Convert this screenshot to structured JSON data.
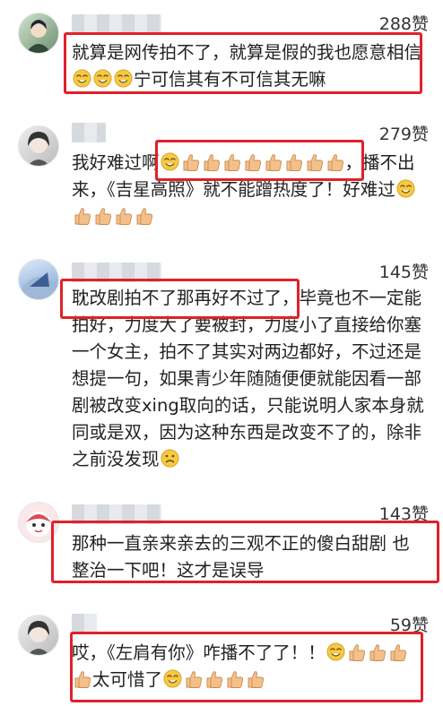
{
  "comments": [
    {
      "likes": "288赞",
      "segments": [
        {
          "t": "text",
          "v": "就算是网传拍不了，就算是假的我也愿意相信"
        },
        {
          "t": "emoji",
          "v": "smile-emoji"
        },
        {
          "t": "emoji",
          "v": "smile-emoji"
        },
        {
          "t": "emoji",
          "v": "smile-emoji"
        },
        {
          "t": "text",
          "v": "宁可信其有不可信其无嘛"
        }
      ]
    },
    {
      "likes": "279赞",
      "segments": [
        {
          "t": "text",
          "v": "我好难过啊"
        },
        {
          "t": "emoji",
          "v": "smile-emoji"
        },
        {
          "t": "thumb",
          "v": "thumbs-up"
        },
        {
          "t": "thumb",
          "v": "thumbs-up"
        },
        {
          "t": "thumb",
          "v": "thumbs-up"
        },
        {
          "t": "thumb",
          "v": "thumbs-up"
        },
        {
          "t": "thumb",
          "v": "thumbs-up"
        },
        {
          "t": "thumb",
          "v": "thumbs-up"
        },
        {
          "t": "thumb",
          "v": "thumbs-up"
        },
        {
          "t": "thumb",
          "v": "thumbs-up"
        },
        {
          "t": "text",
          "v": "，播不出来，《吉星高照》就不能蹭热度了！好难过"
        },
        {
          "t": "emoji",
          "v": "smile-emoji"
        },
        {
          "t": "thumb",
          "v": "thumbs-up"
        },
        {
          "t": "thumb",
          "v": "thumbs-up"
        },
        {
          "t": "thumb",
          "v": "thumbs-up"
        },
        {
          "t": "thumb",
          "v": "thumbs-up"
        }
      ]
    },
    {
      "likes": "145赞",
      "segments": [
        {
          "t": "text",
          "v": "耽改剧拍不了那再好不过了，毕竟也不一定能拍好，力度大了要被封，力度小了直接给你塞一个女主，拍不了其实对两边都好，不过还是想提一句，如果青少年随随便便就能因看一部剧被改变xing取向的话，只能说明人家本身就同或是双，因为这种东西是改变不了的，除非之前没发现"
        },
        {
          "t": "emoji",
          "v": "awkward-emoji"
        }
      ]
    },
    {
      "likes": "143赞",
      "segments": [
        {
          "t": "text",
          "v": "那种一直亲来亲去的三观不正的傻白甜剧 也整治一下吧！这才是误导"
        }
      ]
    },
    {
      "likes": "59赞",
      "segments": [
        {
          "t": "text",
          "v": "哎，《左肩有你》咋播不了了！！"
        },
        {
          "t": "emoji",
          "v": "smile-emoji"
        },
        {
          "t": "thumb",
          "v": "thumbs-up"
        },
        {
          "t": "thumb",
          "v": "thumbs-up"
        },
        {
          "t": "thumb",
          "v": "thumbs-up"
        },
        {
          "t": "thumb",
          "v": "thumbs-up"
        },
        {
          "t": "text",
          "v": "太可惜了"
        },
        {
          "t": "emoji",
          "v": "smile-emoji"
        },
        {
          "t": "thumb",
          "v": "thumbs-up"
        },
        {
          "t": "thumb",
          "v": "thumbs-up"
        },
        {
          "t": "thumb",
          "v": "thumbs-up"
        },
        {
          "t": "thumb",
          "v": "thumbs-up"
        }
      ]
    }
  ],
  "colors": {
    "highlight": "#e0212a",
    "emoji_yellow": "#f6c945",
    "thumb": "#f3c08b"
  }
}
